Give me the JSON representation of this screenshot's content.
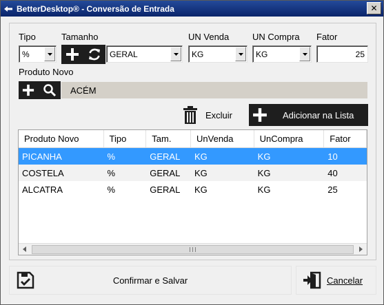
{
  "window": {
    "title": "BetterDesktop® - Conversão de Entrada",
    "close_label": "✕"
  },
  "form": {
    "tipo": {
      "label": "Tipo",
      "value": "%"
    },
    "tamanho": {
      "label": "Tamanho",
      "value": "GERAL"
    },
    "un_venda": {
      "label": "UN Venda",
      "value": "KG"
    },
    "un_compra": {
      "label": "UN Compra",
      "value": "KG"
    },
    "fator": {
      "label": "Fator",
      "value": "25"
    },
    "produto_novo": {
      "label": "Produto Novo",
      "value": "ACÉM"
    }
  },
  "actions": {
    "excluir_label": "Excluir",
    "adicionar_label": "Adicionar na Lista"
  },
  "grid": {
    "columns": [
      "Produto Novo",
      "Tipo",
      "Tam.",
      "UnVenda",
      "UnCompra",
      "Fator"
    ],
    "rows": [
      [
        "PICANHA",
        "%",
        "GERAL",
        "KG",
        "KG",
        "10"
      ],
      [
        "COSTELA",
        "%",
        "GERAL",
        "KG",
        "KG",
        "40"
      ],
      [
        "ALCATRA",
        "%",
        "GERAL",
        "KG",
        "KG",
        "25"
      ]
    ],
    "selected_row": 0
  },
  "footer": {
    "confirm_label": "Confirmar e Salvar",
    "cancel_label": "Cancelar"
  }
}
